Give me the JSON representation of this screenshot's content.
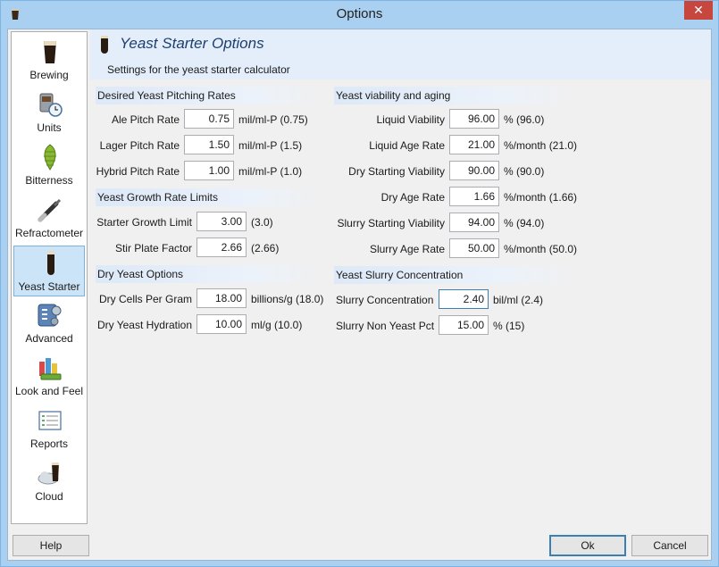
{
  "window": {
    "title": "Options",
    "close_glyph": "✕"
  },
  "sidebar": {
    "items": [
      {
        "label": "Brewing",
        "icon": "beer-glass-icon"
      },
      {
        "label": "Units",
        "icon": "units-icon"
      },
      {
        "label": "Bitterness",
        "icon": "hops-icon"
      },
      {
        "label": "Refractometer",
        "icon": "refractometer-icon"
      },
      {
        "label": "Yeast Starter",
        "icon": "test-tube-icon",
        "active": true
      },
      {
        "label": "Advanced",
        "icon": "advanced-icon"
      },
      {
        "label": "Look and Feel",
        "icon": "palette-icon"
      },
      {
        "label": "Reports",
        "icon": "reports-icon"
      },
      {
        "label": "Cloud",
        "icon": "cloud-icon"
      }
    ]
  },
  "header": {
    "title": "Yeast Starter Options",
    "subtitle": "Settings for the yeast starter calculator"
  },
  "pitching": {
    "title": "Desired Yeast Pitching Rates",
    "rows": [
      {
        "label": "Ale Pitch Rate",
        "value": "0.75",
        "unit": "mil/ml-P (0.75)"
      },
      {
        "label": "Lager Pitch Rate",
        "value": "1.50",
        "unit": "mil/ml-P (1.5)"
      },
      {
        "label": "Hybrid Pitch Rate",
        "value": "1.00",
        "unit": "mil/ml-P (1.0)"
      }
    ]
  },
  "growth": {
    "title": "Yeast Growth Rate Limits",
    "rows": [
      {
        "label": "Starter Growth Limit",
        "value": "3.00",
        "unit": "(3.0)"
      },
      {
        "label": "Stir Plate Factor",
        "value": "2.66",
        "unit": "(2.66)"
      }
    ]
  },
  "dry": {
    "title": "Dry Yeast Options",
    "rows": [
      {
        "label": "Dry Cells Per Gram",
        "value": "18.00",
        "unit": "billions/g (18.0)"
      },
      {
        "label": "Dry Yeast Hydration",
        "value": "10.00",
        "unit": "ml/g (10.0)"
      }
    ]
  },
  "viability": {
    "title": "Yeast viability and aging",
    "rows": [
      {
        "label": "Liquid Viability",
        "value": "96.00",
        "unit": "% (96.0)"
      },
      {
        "label": "Liquid Age Rate",
        "value": "21.00",
        "unit": "%/month (21.0)"
      },
      {
        "label": "Dry Starting Viability",
        "value": "90.00",
        "unit": "% (90.0)"
      },
      {
        "label": "Dry Age Rate",
        "value": "1.66",
        "unit": "%/month (1.66)"
      },
      {
        "label": "Slurry Starting Viability",
        "value": "94.00",
        "unit": "% (94.0)"
      },
      {
        "label": "Slurry Age Rate",
        "value": "50.00",
        "unit": "%/month (50.0)"
      }
    ]
  },
  "slurry": {
    "title": "Yeast Slurry Concentration",
    "rows": [
      {
        "label": "Slurry Concentration",
        "value": "2.40",
        "unit": "bil/ml (2.4)"
      },
      {
        "label": "Slurry Non Yeast Pct",
        "value": "15.00",
        "unit": "% (15)"
      }
    ]
  },
  "buttons": {
    "help": "Help",
    "ok": "Ok",
    "cancel": "Cancel"
  }
}
